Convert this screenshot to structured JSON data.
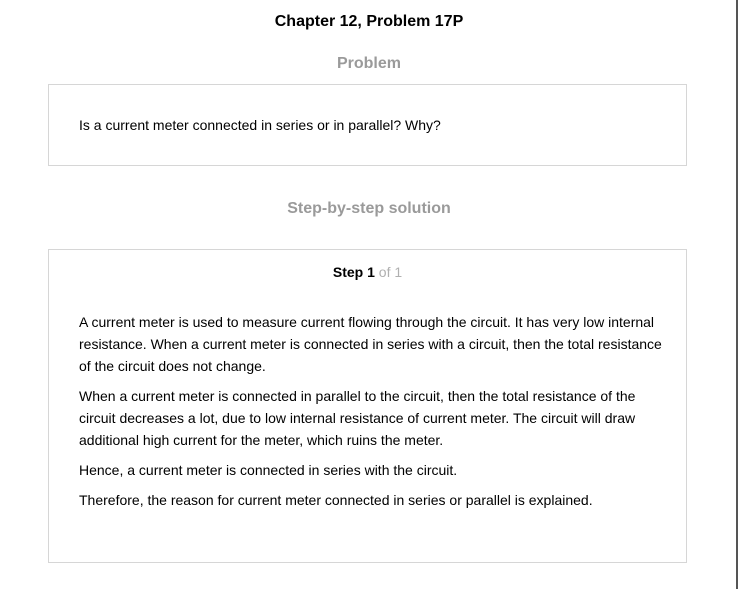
{
  "page": {
    "title": "Chapter 12, Problem 17P"
  },
  "problem": {
    "heading": "Problem",
    "text": "Is a current meter connected in series or in parallel? Why?"
  },
  "solution": {
    "heading": "Step-by-step solution",
    "step": {
      "word": "Step",
      "number": "1",
      "of_text": "of 1"
    },
    "paragraphs": [
      "A current meter is used to measure current flowing through the circuit. It has very low internal resistance. When a current meter is connected in series with a circuit, then the total resistance of the circuit does not change.",
      "When a current meter is connected in parallel to the circuit, then the total resistance of the circuit decreases a lot, due to low internal resistance of current meter. The circuit will draw additional high current for the meter, which ruins the meter.",
      "Hence, a current meter is connected in series with the circuit.",
      "Therefore, the reason for current meter connected in series or parallel is explained."
    ]
  }
}
